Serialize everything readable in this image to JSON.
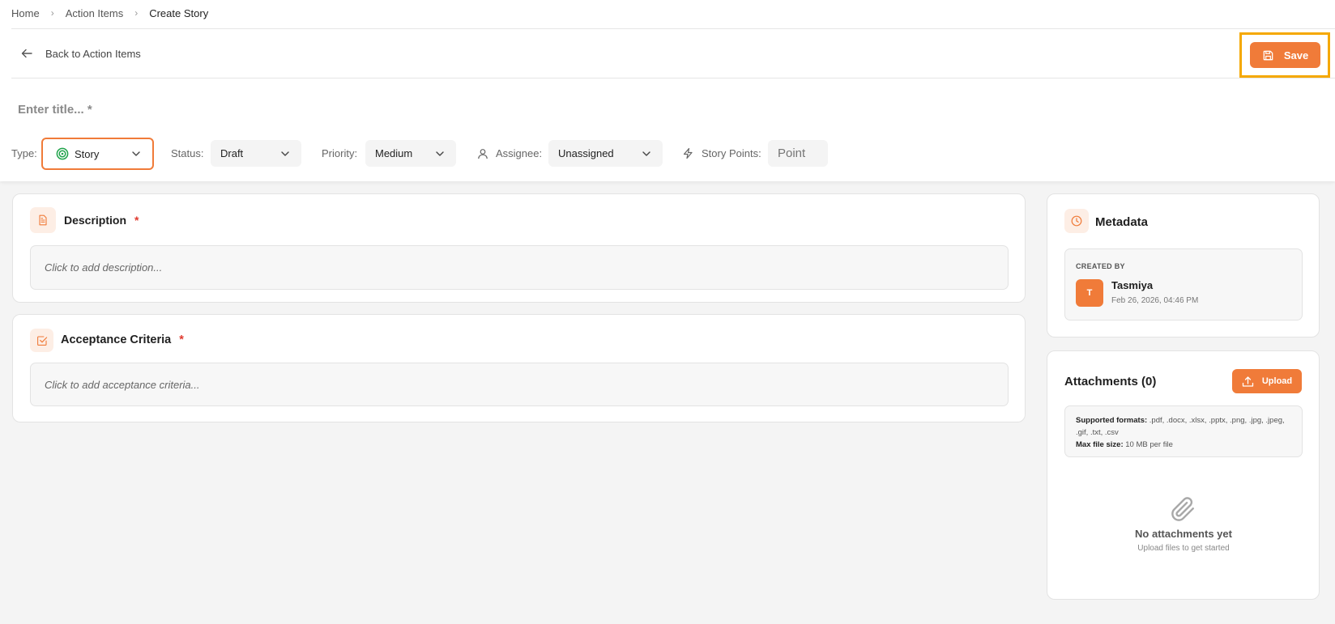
{
  "breadcrumb": {
    "home": "Home",
    "section": "Action Items",
    "current": "Create Story"
  },
  "header": {
    "back_label": "Back to Action Items",
    "save_label": "Save"
  },
  "title_field": {
    "placeholder": "Enter title... *"
  },
  "fields": {
    "type_label": "Type:",
    "type_value": "Story",
    "status_label": "Status:",
    "status_value": "Draft",
    "priority_label": "Priority:",
    "priority_value": "Medium",
    "assignee_label": "Assignee:",
    "assignee_value": "Unassigned",
    "points_label": "Story Points:",
    "points_placeholder": "Point"
  },
  "description": {
    "title": "Description",
    "required_mark": "*",
    "placeholder": "Click to add description..."
  },
  "acceptance": {
    "title": "Acceptance Criteria",
    "required_mark": "*",
    "placeholder": "Click to add acceptance criteria..."
  },
  "metadata": {
    "title": "Metadata",
    "created_by_label": "CREATED BY",
    "avatar_initial": "T",
    "user_name": "Tasmiya",
    "created_date": "Feb 26, 2026, 04:46 PM"
  },
  "attachments": {
    "title": "Attachments (0)",
    "upload_label": "Upload",
    "formats_label": "Supported formats:",
    "formats_value": ".pdf, .docx, .xlsx, .pptx, .png, .jpg, .jpeg, .gif, .txt, .csv",
    "max_size_label": "Max file size:",
    "max_size_value": "10 MB per file",
    "empty_title": "No attachments yet",
    "empty_subtitle": "Upload files to get started"
  },
  "colors": {
    "accent": "#f07b39",
    "highlight": "#f5a800",
    "required": "#e03a2f",
    "type_icon": "#1fa34a"
  }
}
